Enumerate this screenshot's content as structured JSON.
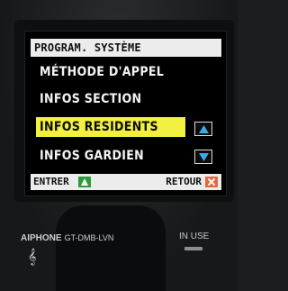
{
  "screen": {
    "title": "PROGRAM. SYSTÈME",
    "menu_items": [
      {
        "label": "MÉTHODE D'APPEL",
        "selected": false
      },
      {
        "label": "INFOS SECTION",
        "selected": false
      },
      {
        "label": "INFOS RESIDENTS",
        "selected": true
      },
      {
        "label": "INFOS GARDIEN",
        "selected": false
      }
    ],
    "footer": {
      "enter_label": "ENTRER",
      "back_label": "RETOUR"
    }
  },
  "device": {
    "brand": "AIPHONE",
    "model": "GT-DMB-LVN",
    "status_label": "IN USE"
  },
  "icons": {
    "scroll_up": "up-arrow-icon",
    "scroll_down": "down-arrow-icon",
    "enter": "enter-up-arrow-icon",
    "back": "close-x-icon",
    "hearing": "ear-icon"
  },
  "colors": {
    "highlight": "#f2f040",
    "scroll_arrow": "#3fa9e6",
    "enter_icon": "#2f9a3a",
    "back_icon": "#e06a3c"
  }
}
